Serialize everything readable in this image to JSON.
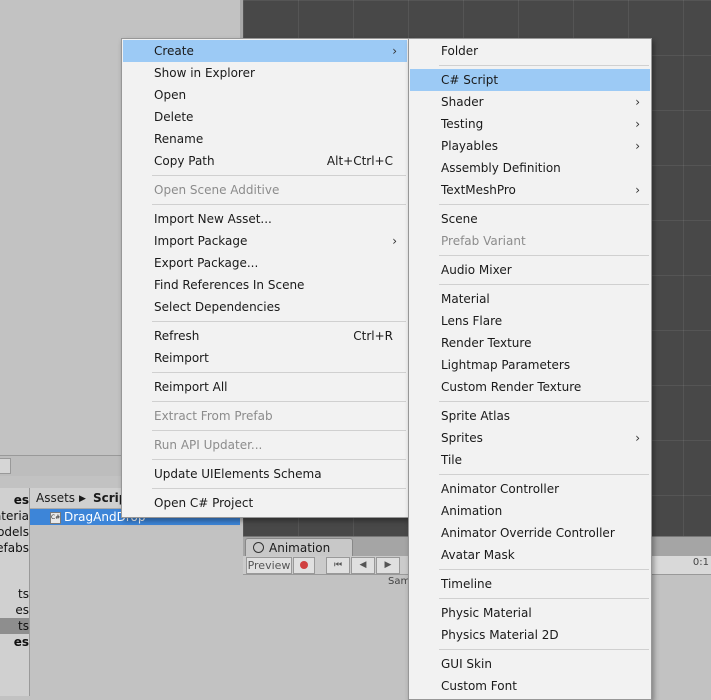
{
  "project": {
    "tree_items": [
      {
        "label": "es",
        "bold": true,
        "selected": false
      },
      {
        "label": "ateria",
        "bold": false,
        "selected": false
      },
      {
        "label": "odels",
        "bold": false,
        "selected": false
      },
      {
        "label": "efabs",
        "bold": false,
        "selected": false
      },
      {
        "label": "ts",
        "bold": false,
        "selected": false
      },
      {
        "label": "es",
        "bold": false,
        "selected": false
      },
      {
        "label": "ts",
        "bold": false,
        "selected": true
      },
      {
        "label": "es",
        "bold": true,
        "selected": false
      }
    ],
    "breadcrumb": {
      "root": "Assets",
      "separator": "▶",
      "current": "Scrip"
    },
    "selected_asset": "DragAndDrop",
    "asset_icon_text": "C#"
  },
  "animation": {
    "tab_label": "Animation",
    "preview_label": "Preview",
    "sample_label": "Sam",
    "timeline_label": "0:1"
  },
  "context_menu": {
    "items": [
      {
        "label": "Create",
        "submenu": true,
        "highlight": true
      },
      {
        "label": "Show in Explorer"
      },
      {
        "label": "Open"
      },
      {
        "label": "Delete"
      },
      {
        "label": "Rename"
      },
      {
        "label": "Copy Path",
        "shortcut": "Alt+Ctrl+C"
      },
      {
        "separator": true
      },
      {
        "label": "Open Scene Additive",
        "disabled": true
      },
      {
        "separator": true
      },
      {
        "label": "Import New Asset..."
      },
      {
        "label": "Import Package",
        "submenu": true
      },
      {
        "label": "Export Package..."
      },
      {
        "label": "Find References In Scene"
      },
      {
        "label": "Select Dependencies"
      },
      {
        "separator": true
      },
      {
        "label": "Refresh",
        "shortcut": "Ctrl+R"
      },
      {
        "label": "Reimport"
      },
      {
        "separator": true
      },
      {
        "label": "Reimport All"
      },
      {
        "separator": true
      },
      {
        "label": "Extract From Prefab",
        "disabled": true
      },
      {
        "separator": true
      },
      {
        "label": "Run API Updater...",
        "disabled": true
      },
      {
        "separator": true
      },
      {
        "label": "Update UIElements Schema"
      },
      {
        "separator": true
      },
      {
        "label": "Open C# Project"
      }
    ]
  },
  "create_submenu": {
    "items": [
      {
        "label": "Folder"
      },
      {
        "separator": true
      },
      {
        "label": "C# Script",
        "highlight": true
      },
      {
        "label": "Shader",
        "submenu": true
      },
      {
        "label": "Testing",
        "submenu": true
      },
      {
        "label": "Playables",
        "submenu": true
      },
      {
        "label": "Assembly Definition"
      },
      {
        "label": "TextMeshPro",
        "submenu": true
      },
      {
        "separator": true
      },
      {
        "label": "Scene"
      },
      {
        "label": "Prefab Variant",
        "disabled": true
      },
      {
        "separator": true
      },
      {
        "label": "Audio Mixer"
      },
      {
        "separator": true
      },
      {
        "label": "Material"
      },
      {
        "label": "Lens Flare"
      },
      {
        "label": "Render Texture"
      },
      {
        "label": "Lightmap Parameters"
      },
      {
        "label": "Custom Render Texture"
      },
      {
        "separator": true
      },
      {
        "label": "Sprite Atlas"
      },
      {
        "label": "Sprites",
        "submenu": true
      },
      {
        "label": "Tile"
      },
      {
        "separator": true
      },
      {
        "label": "Animator Controller"
      },
      {
        "label": "Animation"
      },
      {
        "label": "Animator Override Controller"
      },
      {
        "label": "Avatar Mask"
      },
      {
        "separator": true
      },
      {
        "label": "Timeline"
      },
      {
        "separator": true
      },
      {
        "label": "Physic Material"
      },
      {
        "label": "Physics Material 2D"
      },
      {
        "separator": true
      },
      {
        "label": "GUI Skin"
      },
      {
        "label": "Custom Font"
      }
    ]
  },
  "arrow_glyph": "›"
}
